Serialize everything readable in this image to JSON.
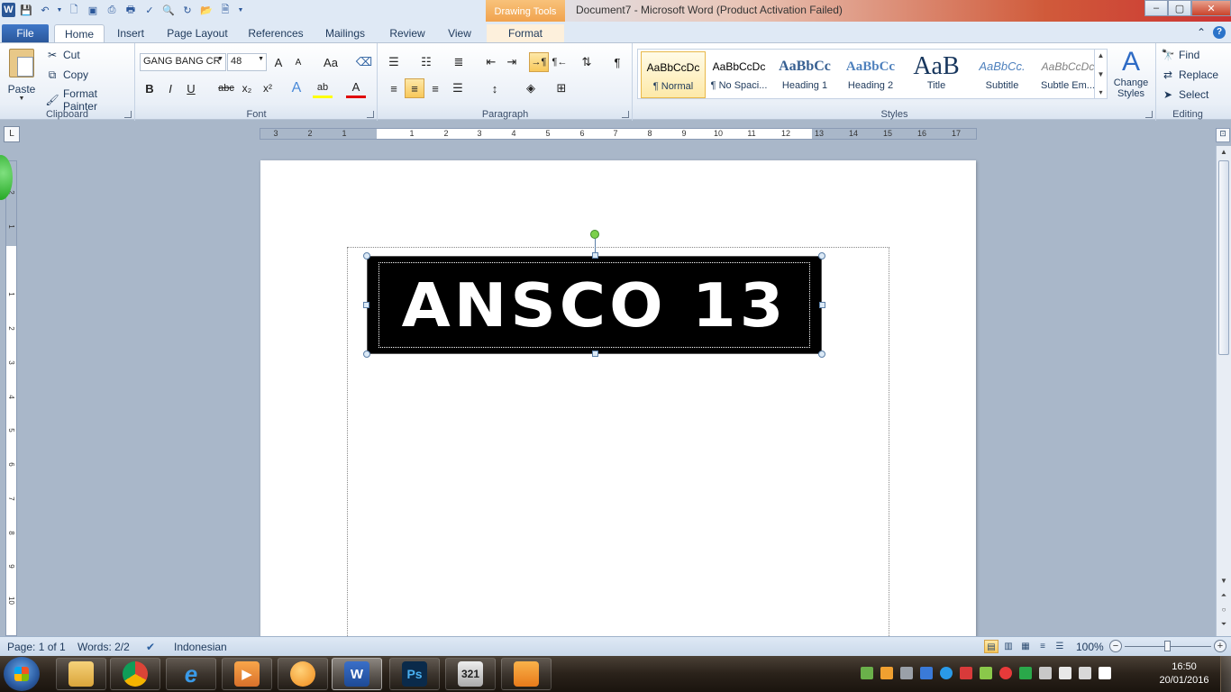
{
  "window": {
    "title": "Document7  -  Microsoft Word (Product Activation Failed)",
    "contextual_tab_group": "Drawing Tools",
    "minimize": "–",
    "maximize": "▢",
    "close": "✕"
  },
  "qat": {
    "word_logo": "W",
    "icons": [
      "save-icon",
      "undo-icon",
      "new-document-icon",
      "open-icon",
      "print-icon",
      "spelling-icon"
    ]
  },
  "tabs": {
    "file": "File",
    "home": "Home",
    "insert": "Insert",
    "page_layout": "Page Layout",
    "references": "References",
    "mailings": "Mailings",
    "review": "Review",
    "view": "View",
    "format": "Format"
  },
  "clipboard": {
    "paste": "Paste",
    "cut": "Cut",
    "copy": "Copy",
    "format_painter": "Format Painter",
    "label": "Clipboard"
  },
  "font": {
    "name": "GANG BANG CR",
    "size": "48",
    "label": "Font",
    "bold": "B",
    "italic": "I",
    "underline": "U",
    "strike": "abc",
    "sub": "x₂",
    "sup": "x²",
    "grow": "A",
    "shrink": "A",
    "case": "Aa",
    "highlight": "ab",
    "color": "A",
    "effects": "A"
  },
  "paragraph": {
    "label": "Paragraph",
    "pilcrow": "¶"
  },
  "styles": {
    "label": "Styles",
    "items": [
      {
        "sample": "AaBbCcDc",
        "name": "¶ Normal"
      },
      {
        "sample": "AaBbCcDc",
        "name": "¶ No Spaci..."
      },
      {
        "sample": "AaBbCc",
        "name": "Heading 1"
      },
      {
        "sample": "AaBbCc",
        "name": "Heading 2"
      },
      {
        "sample": "AaB",
        "name": "Title"
      },
      {
        "sample": "AaBbCc.",
        "name": "Subtitle"
      },
      {
        "sample": "AaBbCcDc",
        "name": "Subtle Em..."
      }
    ],
    "change_styles": "Change Styles"
  },
  "editing": {
    "label": "Editing",
    "find": "Find",
    "replace": "Replace",
    "select": "Select"
  },
  "ruler": {
    "h_numbers": [
      "3",
      "2",
      "1",
      "1",
      "2",
      "3",
      "4",
      "5",
      "6",
      "7",
      "8",
      "9",
      "10",
      "11",
      "12",
      "13",
      "14",
      "15",
      "16",
      "17"
    ],
    "v_numbers": [
      "2",
      "1",
      "1",
      "2",
      "3",
      "4",
      "5",
      "6",
      "7",
      "8",
      "9",
      "10"
    ],
    "tab_selector": "L"
  },
  "document": {
    "wordart": "ANSCO 13"
  },
  "status": {
    "page": "Page: 1 of 1",
    "words": "Words: 2/2",
    "language": "Indonesian",
    "zoom": "100%"
  },
  "taskbar": {
    "time": "16:50",
    "date": "20/01/2016",
    "apps": [
      "explorer",
      "chrome",
      "internet-explorer",
      "media-player",
      "winamp",
      "word",
      "photoshop",
      "media-player-classic",
      "uc-browser"
    ]
  }
}
